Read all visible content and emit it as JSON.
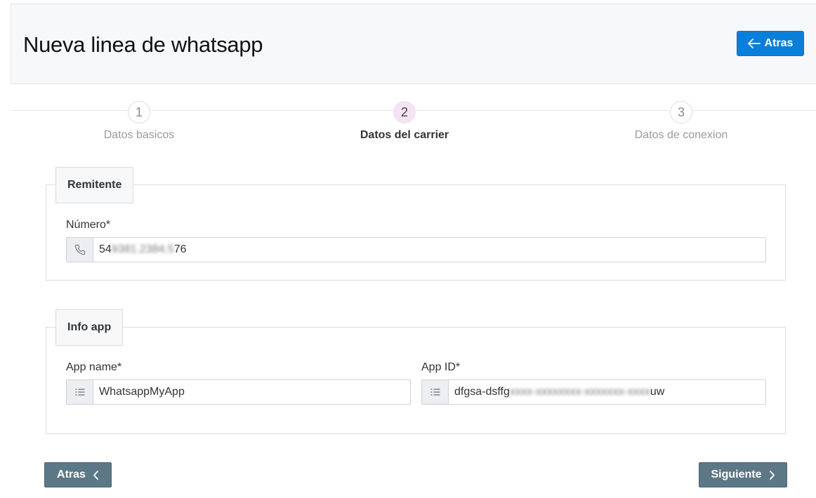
{
  "header": {
    "title": "Nueva linea de whatsapp",
    "back_label": "Atras"
  },
  "steps": [
    {
      "number": "1",
      "label": "Datos basicos",
      "active": false
    },
    {
      "number": "2",
      "label": "Datos del carrier",
      "active": true
    },
    {
      "number": "3",
      "label": "Datos de conexion",
      "active": false
    }
  ],
  "remitente": {
    "legend": "Remitente",
    "numero_label": "Número*",
    "numero_value_visible_start": "54",
    "numero_value_blurred": "9381.2384.5",
    "numero_value_visible_end": "76",
    "numero_icon": "phone-icon"
  },
  "info_app": {
    "legend": "Info app",
    "app_name_label": "App name*",
    "app_name_value": "WhatsappMyApp",
    "app_name_icon": "list-icon",
    "app_id_label": "App ID*",
    "app_id_value_visible": "dfgsa-dsffg",
    "app_id_value_blurred": "xxxx-xxxxxxxx-xxxxxxx-xxxx",
    "app_id_value_visible_end": "uw",
    "app_id_icon": "list-icon"
  },
  "footer": {
    "prev_label": "Atras",
    "next_label": "Siguiente"
  },
  "colors": {
    "primary": "#0a7fd9",
    "nav_button": "#5c7785",
    "active_step": "#f4e3f3"
  }
}
